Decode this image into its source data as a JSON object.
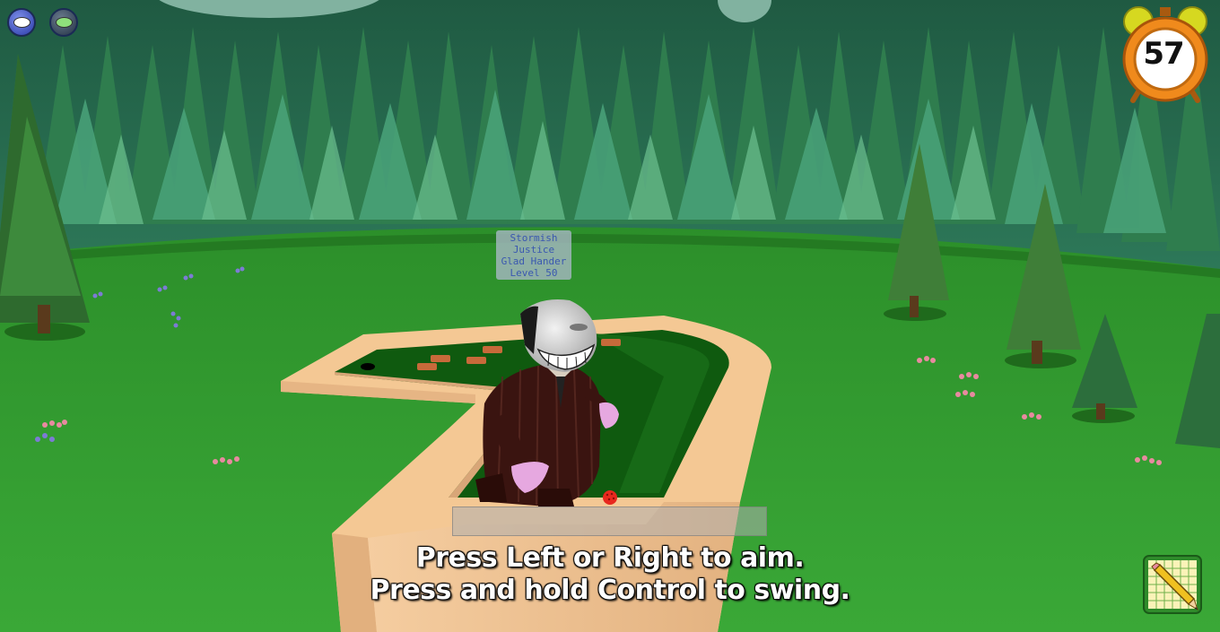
{
  "hud": {
    "chat_buttons": [
      {
        "icon": "speech-bubble-icon",
        "color": "#2a3aa8"
      },
      {
        "icon": "quick-chat-bubble-icon",
        "color": "#233245"
      }
    ],
    "timer": {
      "value": "57",
      "icon": "alarm-clock-icon",
      "color": "#f08a1c"
    },
    "power_bar": {
      "level": 0
    },
    "instructions": [
      "Press Left or Right to aim.",
      "Press and hold Control to swing."
    ],
    "shticker_book": {
      "icon": "shticker-book-pencil-icon"
    }
  },
  "character": {
    "nametag": [
      "Stormish",
      "Justice",
      "Glad Hander",
      "Level 50"
    ],
    "nametag_color": "#3a58b0"
  },
  "colors": {
    "grass": "#2f9a2c",
    "course_wall": "#f0c090",
    "putting_green": "#0f5a0f",
    "suit": "#3a1410"
  }
}
